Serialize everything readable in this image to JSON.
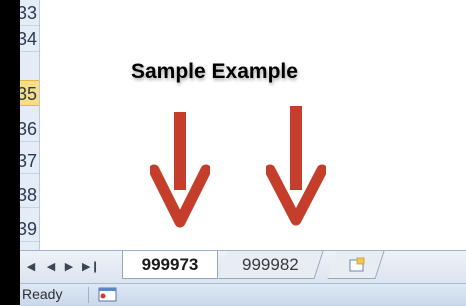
{
  "row_headers": [
    "33",
    "34",
    "35",
    "36",
    "37",
    "38",
    "39"
  ],
  "active_row": "35",
  "annotation": {
    "title": "Sample Example"
  },
  "sheet_nav": [
    "first-sheet",
    "previous-sheet",
    "next-sheet",
    "last-sheet"
  ],
  "sheet_tabs": [
    {
      "label": "999973",
      "active": true
    },
    {
      "label": "999982",
      "active": false
    }
  ],
  "status": {
    "text": "Ready"
  },
  "colors": {
    "arrow": "#c43e2b",
    "active_row_header": "#f9dd84",
    "row_header_bg": "#e4ecf7"
  },
  "icons": [
    "new-sheet-icon",
    "macro-record-icon"
  ]
}
